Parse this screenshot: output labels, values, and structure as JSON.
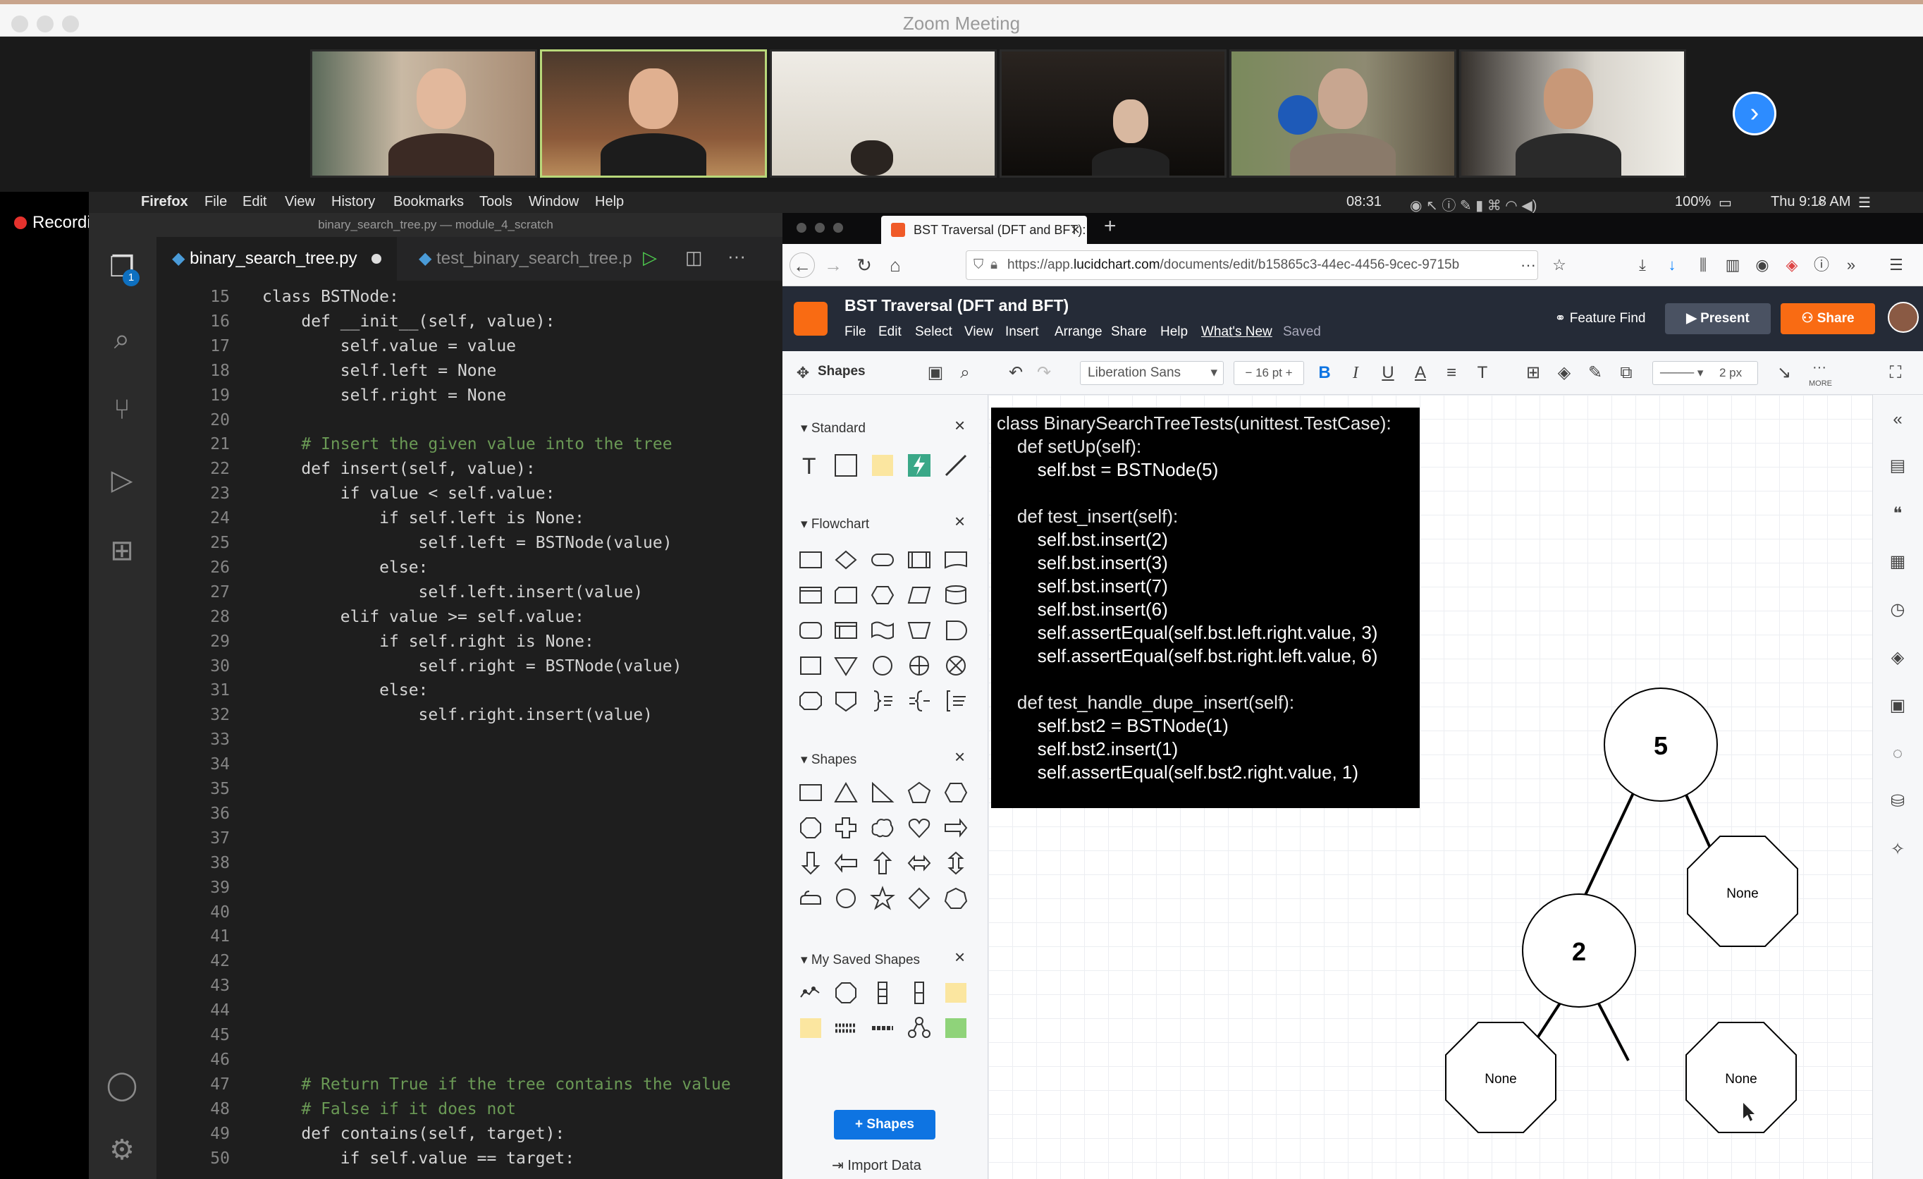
{
  "zoom": {
    "title": "Zoom Meeting",
    "recording_label": "Recording"
  },
  "mac_menu": {
    "items": [
      "Firefox",
      "File",
      "Edit",
      "View",
      "History",
      "Bookmarks",
      "Tools",
      "Window",
      "Help"
    ],
    "clock_left": "08:31",
    "battery": "100%",
    "datetime": "Thu 9:18 AM"
  },
  "vscode": {
    "window_title": "binary_search_tree.py — module_4_scratch",
    "tabs": [
      {
        "label": "binary_search_tree.py",
        "active": true
      },
      {
        "label": "test_binary_search_tree.p",
        "active": false
      }
    ],
    "badge_count": "1",
    "line_numbers": [
      "15",
      "16",
      "17",
      "18",
      "19",
      "20",
      "21",
      "22",
      "23",
      "24",
      "25",
      "26",
      "27",
      "28",
      "29",
      "30",
      "31",
      "32",
      "33",
      "34",
      "35",
      "36",
      "37",
      "38",
      "39",
      "40",
      "41",
      "42",
      "43",
      "44",
      "45",
      "46",
      "47",
      "48",
      "49",
      "50"
    ],
    "code_lines": [
      "class BSTNode:",
      "    def __init__(self, value):",
      "        self.value = value",
      "        self.left = None",
      "        self.right = None",
      "",
      "    # Insert the given value into the tree",
      "    def insert(self, value):",
      "        if value < self.value:",
      "            if self.left is None:",
      "                self.left = BSTNode(value)",
      "            else:",
      "                self.left.insert(value)",
      "        elif value >= self.value:",
      "            if self.right is None:",
      "                self.right = BSTNode(value)",
      "            else:",
      "                self.right.insert(value)",
      "",
      "",
      "",
      "",
      "",
      "",
      "",
      "",
      "",
      "",
      "",
      "",
      "",
      "",
      "    # Return True if the tree contains the value",
      "    # False if it does not",
      "    def contains(self, target):",
      "        if self.value == target:"
    ]
  },
  "firefox": {
    "tab_title": "BST Traversal (DFT and BFT): L",
    "url_prefix": "https://app.",
    "url_domain": "lucidchart.com",
    "url_suffix": "/documents/edit/b15865c3-44ec-4456-9cec-9715b"
  },
  "lucidchart": {
    "doc_title": "BST Traversal (DFT and BFT)",
    "menu": [
      "File",
      "Edit",
      "Select",
      "View",
      "Insert",
      "Arrange",
      "Share",
      "Help",
      "What's New"
    ],
    "saved_status": "Saved",
    "feature_find": "Feature Find",
    "present": "Present",
    "share": "Share",
    "toolbar": {
      "font": "Liberation Sans",
      "font_size": "16 pt",
      "line_width": "2 px",
      "more": "MORE"
    },
    "shapes_panel": {
      "title": "Shapes",
      "sections": [
        "Standard",
        "Flowchart",
        "Shapes",
        "My Saved Shapes"
      ],
      "add_shapes": "Shapes",
      "import_data": "Import Data"
    },
    "code_card_lines": [
      "class BinarySearchTreeTests(unittest.TestCase):",
      "    def setUp(self):",
      "        self.bst = BSTNode(5)",
      "",
      "    def test_insert(self):",
      "        self.bst.insert(2)",
      "        self.bst.insert(3)",
      "        self.bst.insert(7)",
      "        self.bst.insert(6)",
      "        self.assertEqual(self.bst.left.right.value, 3)",
      "        self.assertEqual(self.bst.right.left.value, 6)",
      "",
      "    def test_handle_dupe_insert(self):",
      "        self.bst2 = BSTNode(1)",
      "        self.bst2.insert(1)",
      "        self.assertEqual(self.bst2.right.value, 1)"
    ],
    "tree": {
      "root": "5",
      "left": "2",
      "right_leaf": "None",
      "left_left": "None",
      "left_right": "None"
    }
  },
  "colors": {
    "lucid_orange": "#f96b13",
    "lucid_blue": "#0e74e2",
    "vscode_bg": "#1e1e1e",
    "zoom_blue": "#2d8cff"
  }
}
